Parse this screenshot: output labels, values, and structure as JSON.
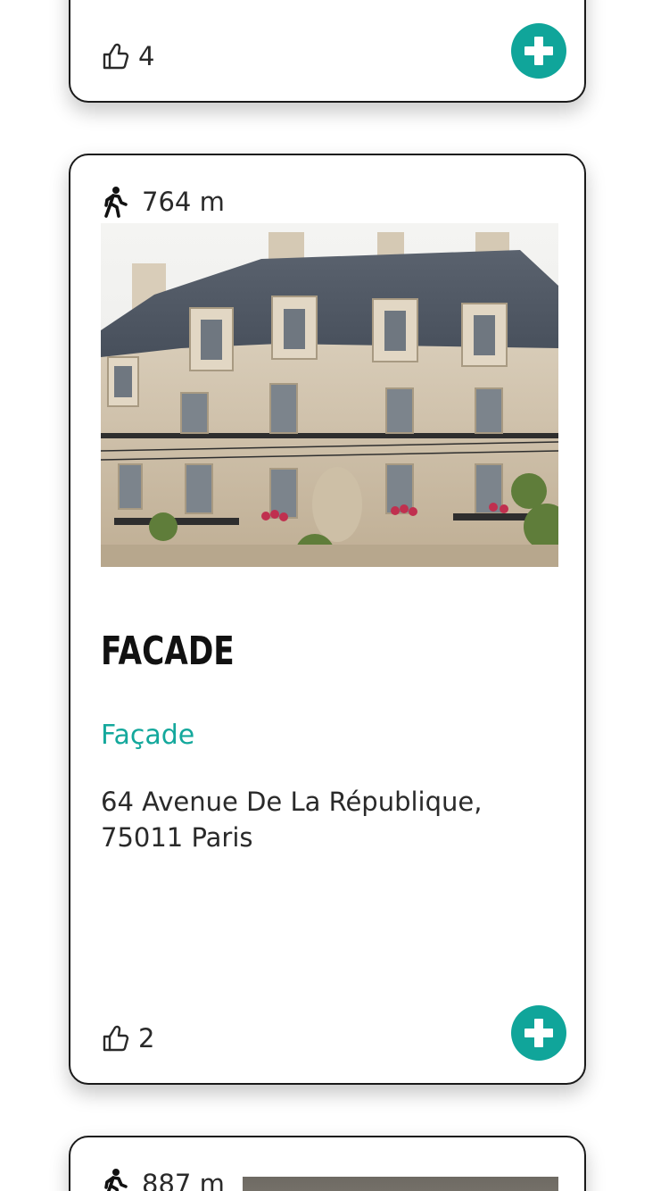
{
  "cards": [
    {
      "likes": "4",
      "add_label": "Add"
    },
    {
      "distance": "764 m",
      "title": "FACADE",
      "category": "Façade",
      "address": "64 Avenue De La République, 75011 Paris",
      "likes": "2",
      "add_label": "Add"
    },
    {
      "distance": "887 m"
    }
  ],
  "colors": {
    "accent": "#10a59a",
    "text": "#1a1a1a"
  },
  "icons": {
    "like": "thumbs-up-icon",
    "add": "plus-circle-icon",
    "walk": "pedestrian-icon"
  }
}
